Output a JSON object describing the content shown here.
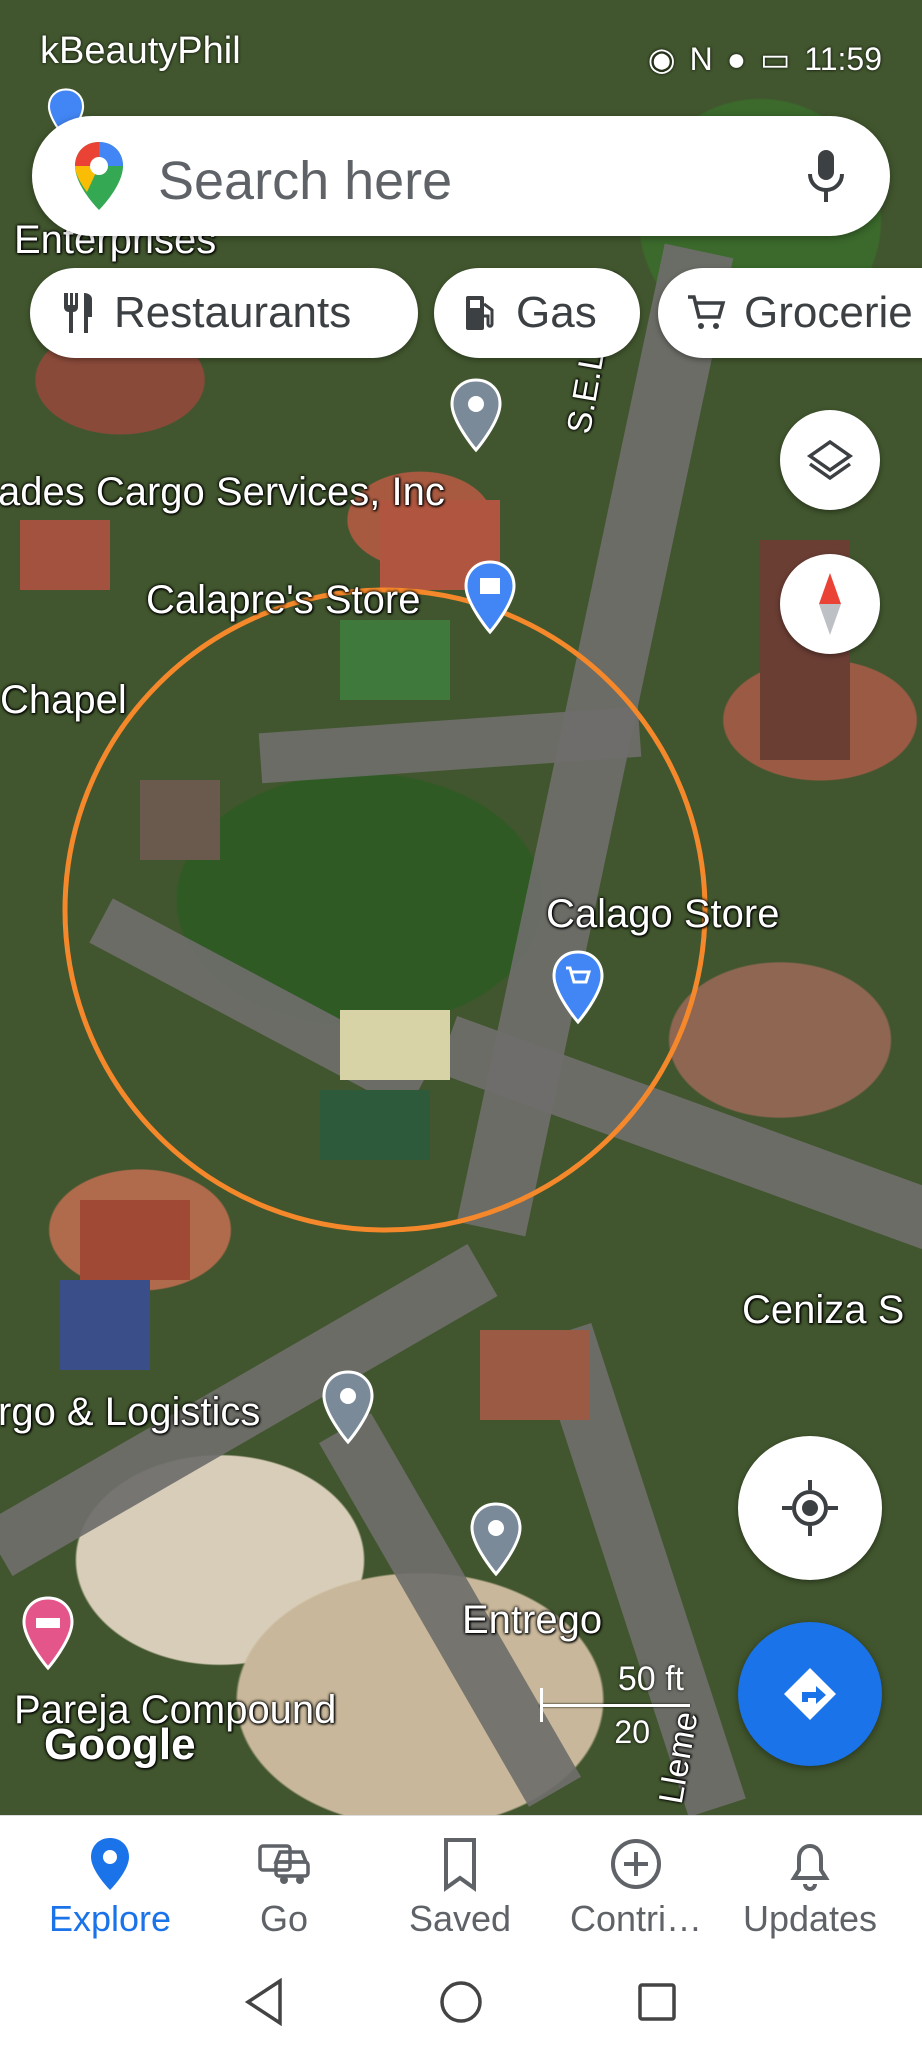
{
  "status_bar": {
    "carrier": "kBeautyPhil",
    "time": "11:59"
  },
  "search": {
    "placeholder": "Search here"
  },
  "chips": [
    {
      "label": "Restaurants",
      "icon": "fork-knife-icon"
    },
    {
      "label": "Gas",
      "icon": "gas-pump-icon"
    },
    {
      "label": "Grocerie",
      "icon": "cart-icon"
    }
  ],
  "map": {
    "labels": {
      "enterprises": "Enterprises",
      "cargo_services": "ades Cargo Services, Inc",
      "calapre_store": "Calapre's Store",
      "chapel": "Chapel",
      "street_llenes": "S.E.Llenes",
      "calago_store": "Calago Store",
      "ceniza": "Ceniza S",
      "cargo_logistics": "rgo & Logistics",
      "entrego": "Entrego",
      "pareja": "Pareja Compound",
      "street_llenes_bottom": "Lleme",
      "google": "Google"
    },
    "scale": {
      "feet": "50 ft",
      "meters": "20"
    },
    "highlight_circle_color": "#f5882a"
  },
  "bottom_nav": [
    {
      "label": "Explore",
      "icon": "explore-pin-icon",
      "active": true
    },
    {
      "label": "Go",
      "icon": "car-icon",
      "active": false
    },
    {
      "label": "Saved",
      "icon": "bookmark-icon",
      "active": false
    },
    {
      "label": "Contri…",
      "icon": "add-circle-icon",
      "active": false
    },
    {
      "label": "Updates",
      "icon": "bell-icon",
      "active": false
    }
  ],
  "colors": {
    "accent": "#1a73e8",
    "directions_fab": "#1a73e8"
  }
}
